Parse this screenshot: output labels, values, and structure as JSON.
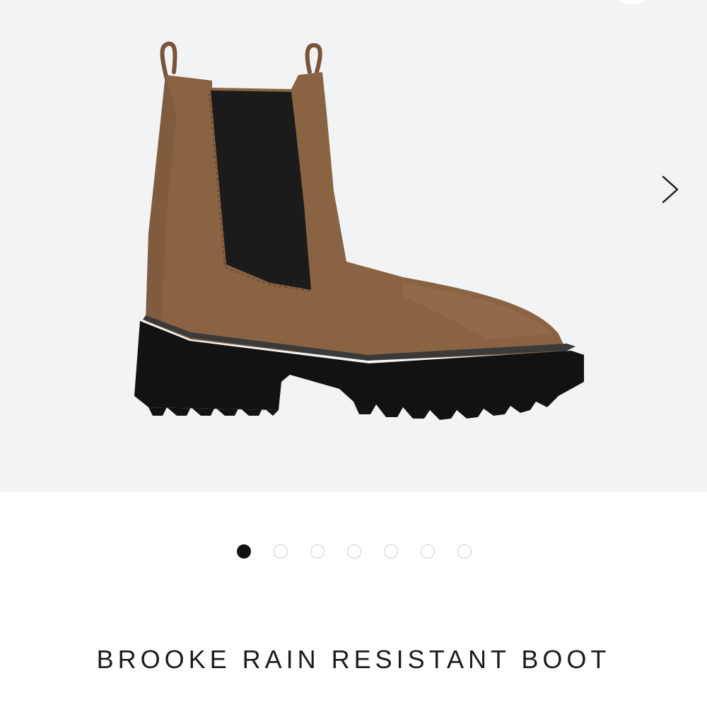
{
  "product": {
    "title": "BROOKE RAIN RESISTANT BOOT",
    "image_alt": "boot-product-photo"
  },
  "gallery": {
    "total_images": 7,
    "active_index": 0,
    "next_icon": "chevron-right-icon"
  },
  "colors": {
    "background": "#f2f3f5",
    "suede": "#8a6343",
    "sole": "#121212",
    "elastic": "#1b1b1b",
    "dot_active": "#111111",
    "dot_inactive": "#cfcfcf"
  }
}
